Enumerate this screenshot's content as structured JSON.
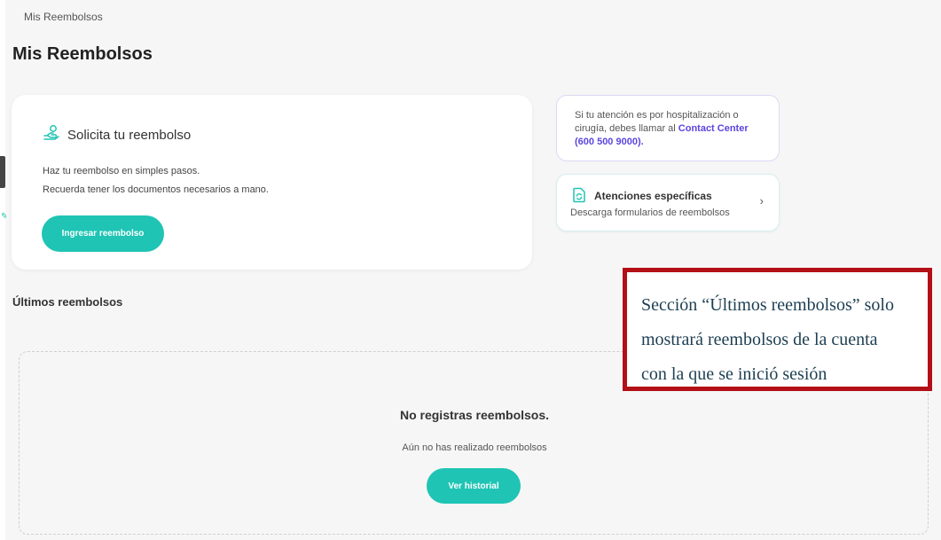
{
  "breadcrumb": "Mis Reembolsos",
  "page_title": "Mis Reembolsos",
  "request_card": {
    "title": "Solicita tu reembolso",
    "line1": "Haz tu reembolso en simples pasos.",
    "line2": "Recuerda tener los documentos necesarios a mano.",
    "button_label": "Ingresar reembolso"
  },
  "info_card": {
    "line1": "Si tu atención es por hospitalización o",
    "line2_prefix": "cirugía, debes llamar al ",
    "contact_name": "Contact Center",
    "contact_phone": "(600 500 9000)."
  },
  "forms_card": {
    "title": "Atenciones específicas",
    "subtitle": "Descarga formularios de reembolsos"
  },
  "section": {
    "title": "Últimos reembolsos",
    "empty_title": "No registras reembolsos.",
    "empty_subtitle": "Aún no has realizado reembolsos",
    "button_label": "Ver historial"
  },
  "annotation": {
    "line1": "Sección “Últimos reembolsos” solo",
    "line2": "mostrará reembolsos de la cuenta",
    "line3": "con la que se inició sesión"
  },
  "colors": {
    "accent": "#1fc4b4",
    "link": "#5b45e0",
    "annotation_border": "#b30f16"
  },
  "icons": [
    "hand-coin-icon",
    "document-refresh-icon",
    "chevron-right-icon"
  ]
}
